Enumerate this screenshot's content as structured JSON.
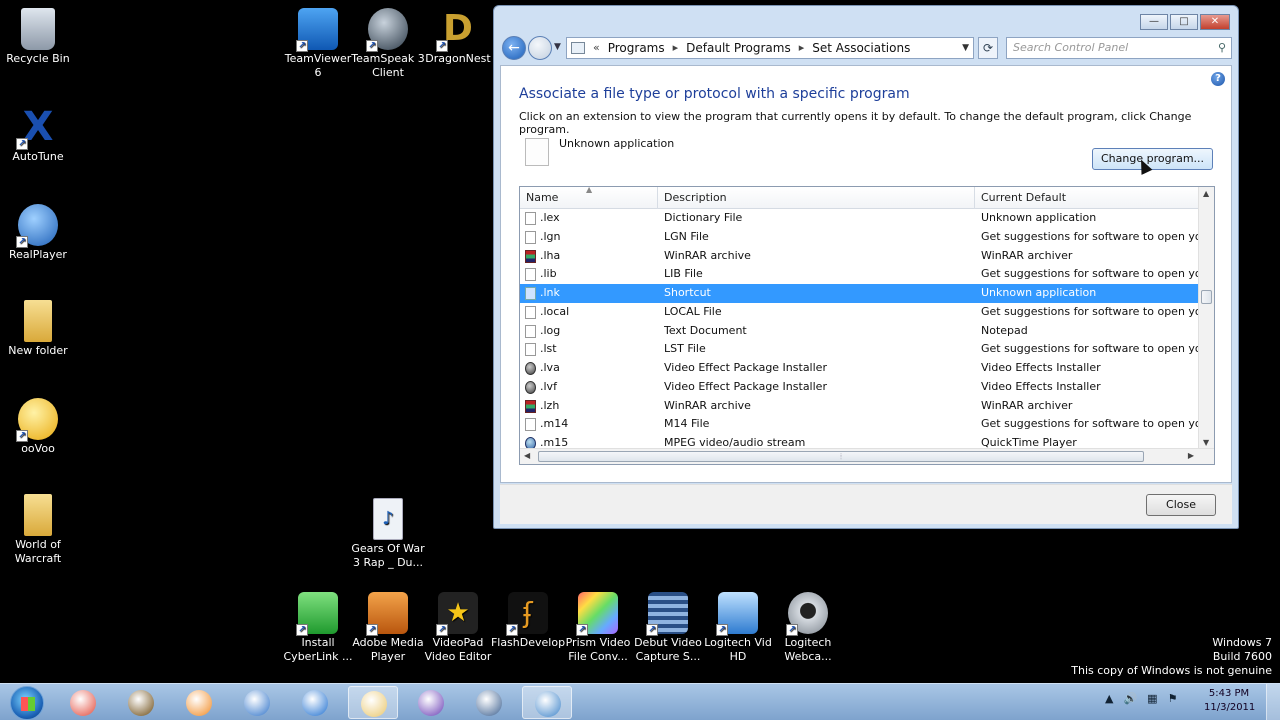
{
  "desktop": {
    "left_icons": [
      {
        "label": "Recycle Bin",
        "icon": "recycle-bin-icon",
        "color": "#9aa7b5"
      },
      {
        "label": "AutoTune",
        "icon": "autotune-icon",
        "color": "#1a4fb0"
      },
      {
        "label": "RealPlayer",
        "icon": "realplayer-icon",
        "color": "#2a7fd6"
      },
      {
        "label": "New folder",
        "icon": "folder-icon",
        "color": "#e8c56a"
      },
      {
        "label": "ooVoo",
        "icon": "oovoo-icon",
        "color": "#f2c12e"
      },
      {
        "label": "World of Warcraft",
        "icon": "folder-icon",
        "color": "#e8c56a"
      }
    ],
    "top_icons": [
      {
        "label": "TeamViewer 6",
        "icon": "teamviewer-icon",
        "color": "#1d6fd1"
      },
      {
        "label": "TeamSpeak 3 Client",
        "icon": "teamspeak-icon",
        "color": "#445566"
      },
      {
        "label": "DragonNest",
        "icon": "dragonnest-icon",
        "color": "#b38a22"
      }
    ],
    "file_icon": {
      "label": "Gears Of War 3 Rap _ Du...",
      "icon": "audio-file-icon",
      "color": "#e8eef6"
    },
    "bottom_icons": [
      {
        "label": "Install CyberLink ...",
        "icon": "cyberlink-icon",
        "color": "#3fbf3f"
      },
      {
        "label": "Adobe Media Player",
        "icon": "adobe-media-player-icon",
        "color": "#e07b1a"
      },
      {
        "label": "VideoPad Video Editor",
        "icon": "videopad-icon",
        "color": "#222222"
      },
      {
        "label": "FlashDevelop",
        "icon": "flashdevelop-icon",
        "color": "#d98a1c"
      },
      {
        "label": "Prism Video File Conv...",
        "icon": "prism-icon",
        "color": "#8a5cc9"
      },
      {
        "label": "Debut Video Capture S...",
        "icon": "debut-icon",
        "color": "#3c6fb6"
      },
      {
        "label": "Logitech Vid HD",
        "icon": "logitech-vid-icon",
        "color": "#3a8fd8"
      },
      {
        "label": "Logitech Webca...",
        "icon": "webcam-icon",
        "color": "#b8bec6"
      }
    ]
  },
  "watermark": {
    "line1": "Windows 7",
    "line2": "Build 7600",
    "line3": "This copy of Windows is not genuine"
  },
  "window": {
    "controls": {
      "minimize": "—",
      "maximize": "□",
      "close": "✕"
    },
    "breadcrumb": [
      "Programs",
      "Default Programs",
      "Set Associations"
    ],
    "breadcrumb_prefix": "«",
    "search_placeholder": "Search Control Panel",
    "heading": "Associate a file type or protocol with a specific program",
    "instructions": "Click on an extension to view the program that currently opens it by default. To change the default program, click Change program.",
    "current_app": "Unknown application",
    "change_button": "Change program...",
    "close_button": "Close",
    "columns": {
      "name": "Name",
      "description": "Description",
      "default": "Current Default"
    },
    "rows": [
      {
        "name": ".lex",
        "description": "Dictionary File",
        "default": "Unknown application",
        "icon": "blank"
      },
      {
        "name": ".lgn",
        "description": "LGN File",
        "default": "Get suggestions for software to open your fi",
        "icon": "blank"
      },
      {
        "name": ".lha",
        "description": "WinRAR archive",
        "default": "WinRAR archiver",
        "icon": "winrar"
      },
      {
        "name": ".lib",
        "description": "LIB File",
        "default": "Get suggestions for software to open your fi",
        "icon": "blank"
      },
      {
        "name": ".lnk",
        "description": "Shortcut",
        "default": "Unknown application",
        "icon": "lnk",
        "selected": true
      },
      {
        "name": ".local",
        "description": "LOCAL File",
        "default": "Get suggestions for software to open your fi",
        "icon": "blank"
      },
      {
        "name": ".log",
        "description": "Text Document",
        "default": "Notepad",
        "icon": "blank"
      },
      {
        "name": ".lst",
        "description": "LST File",
        "default": "Get suggestions for software to open your fi",
        "icon": "blank"
      },
      {
        "name": ".lva",
        "description": "Video Effect Package Installer",
        "default": "Video Effects Installer",
        "icon": "video"
      },
      {
        "name": ".lvf",
        "description": "Video Effect Package Installer",
        "default": "Video Effects Installer",
        "icon": "video"
      },
      {
        "name": ".lzh",
        "description": "WinRAR archive",
        "default": "WinRAR archiver",
        "icon": "winrar"
      },
      {
        "name": ".m14",
        "description": "M14 File",
        "default": "Get suggestions for software to open your fi",
        "icon": "blank"
      },
      {
        "name": ".m15",
        "description": "MPEG video/audio stream",
        "default": "QuickTime Player",
        "icon": "mpeg"
      }
    ]
  },
  "taskbar": {
    "items": [
      {
        "icon": "chrome-icon",
        "color": "#e24a3b"
      },
      {
        "icon": "warcraft-icon",
        "color": "#6b4a12"
      },
      {
        "icon": "media-player-icon",
        "color": "#f08a24"
      },
      {
        "icon": "teamspeak-icon",
        "color": "#2f73c9"
      },
      {
        "icon": "itunes-icon",
        "color": "#1e6fd0"
      },
      {
        "icon": "explorer-folder-icon",
        "color": "#e9c66b",
        "active": true
      },
      {
        "icon": "opera-icon",
        "color": "#6a3fb5"
      },
      {
        "icon": "film-icon",
        "color": "#3b5f8f"
      },
      {
        "icon": "control-panel-icon",
        "color": "#3d83c9",
        "active": true
      }
    ],
    "clock_time": "5:43 PM",
    "clock_date": "11/3/2011"
  }
}
